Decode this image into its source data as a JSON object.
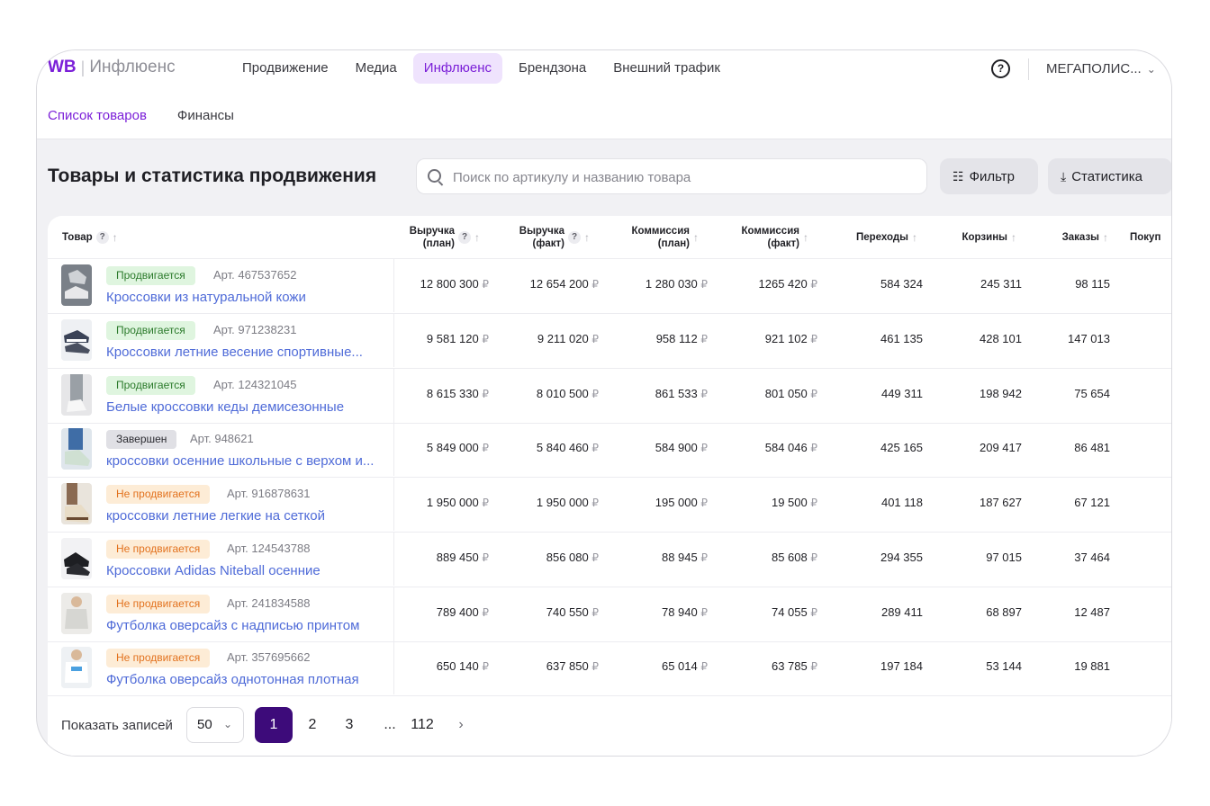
{
  "header": {
    "logo_wb": "WB",
    "logo_sep": "|",
    "logo_name": "Инфлюенс",
    "nav": [
      "Продвижение",
      "Медиа",
      "Инфлюенс",
      "Брендзона",
      "Внешний трафик"
    ],
    "nav_active": 2,
    "help": "?",
    "account": "МЕГАПОЛИС..."
  },
  "subnav": [
    "Список товаров",
    "Финансы"
  ],
  "page": {
    "title": "Товары и статистика продвижения",
    "search_placeholder": "Поиск по артикулу и названию товара",
    "filter_label": "Фильтр",
    "stats_label": "Статистика"
  },
  "table": {
    "col_product": "Товар",
    "columns": [
      {
        "l1": "Выручка",
        "l2": "(план)",
        "help": "?"
      },
      {
        "l1": "Выручка",
        "l2": "(факт)",
        "help": "?"
      },
      {
        "l1": "Коммиссия",
        "l2": "(план)"
      },
      {
        "l1": "Коммиссия",
        "l2": "(факт)"
      },
      {
        "l1": "Переходы"
      },
      {
        "l1": "Корзины"
      },
      {
        "l1": "Заказы"
      },
      {
        "l1": "Покуп"
      }
    ],
    "rub": "₽",
    "rows": [
      {
        "status": "Продвигается",
        "kind": "g",
        "art": "Арт. 467537652",
        "name": "Кроссовки из натуральной кожи",
        "vals": [
          "12 800 300",
          "12 654 200",
          "1 280 030",
          "1265 420"
        ],
        "nums": [
          "584 324",
          "245 311",
          "98 115"
        ]
      },
      {
        "status": "Продвигается",
        "kind": "g",
        "art": "Арт. 971238231",
        "name": "Кроссовки летние весение спортивные...",
        "vals": [
          "9 581 120",
          "9 211 020",
          "958 112",
          "921 102"
        ],
        "nums": [
          "461 135",
          "428 101",
          "147 013"
        ]
      },
      {
        "status": "Продвигается",
        "kind": "g",
        "art": "Арт. 124321045",
        "name": "Белые кроссовки кеды демисезонные",
        "vals": [
          "8 615 330",
          "8 010 500",
          "861 533",
          "801 050"
        ],
        "nums": [
          "449 311",
          "198 942",
          "75 654"
        ]
      },
      {
        "status": "Завершен",
        "kind": "s",
        "art": "Арт. 948621",
        "name": "кроссовки осенние школьные с верхом и...",
        "vals": [
          "5 849 000",
          "5 840 460",
          "584 900",
          "584 046"
        ],
        "nums": [
          "425 165",
          "209 417",
          "86 481"
        ]
      },
      {
        "status": "Не продвигается",
        "kind": "o",
        "art": "Арт. 916878631",
        "name": "кроссовки летние легкие на сеткой",
        "vals": [
          "1 950 000",
          "1 950 000",
          "195 000",
          "19 500"
        ],
        "nums": [
          "401 118",
          "187 627",
          "67 121"
        ]
      },
      {
        "status": "Не продвигается",
        "kind": "o",
        "art": "Арт. 124543788",
        "name": "Кроссовки Adidas Niteball осенние",
        "vals": [
          "889 450",
          "856 080",
          "88 945",
          "85 608"
        ],
        "nums": [
          "294 355",
          "97 015",
          "37 464"
        ]
      },
      {
        "status": "Не продвигается",
        "kind": "o",
        "art": "Арт. 241834588",
        "name": "Футболка оверсайз с надписью принтом",
        "vals": [
          "789 400",
          "740 550",
          "78 940",
          "74 055"
        ],
        "nums": [
          "289 411",
          "68 897",
          "12 487"
        ]
      },
      {
        "status": "Не продвигается",
        "kind": "o",
        "art": "Арт. 357695662",
        "name": "Футболка оверсайз однотонная плотная",
        "vals": [
          "650 140",
          "637 850",
          "65 014",
          "63 785"
        ],
        "nums": [
          "197 184",
          "53 144",
          "19 881"
        ]
      }
    ]
  },
  "pagination": {
    "label": "Показать записей",
    "per_page": "50",
    "pages": [
      "1",
      "2",
      "3",
      "...",
      "112"
    ],
    "current": "1",
    "next": "›"
  },
  "colors": {
    "brand": "#7b1fd8",
    "link": "#4f6bd8",
    "page_active": "#3d0b7a"
  }
}
